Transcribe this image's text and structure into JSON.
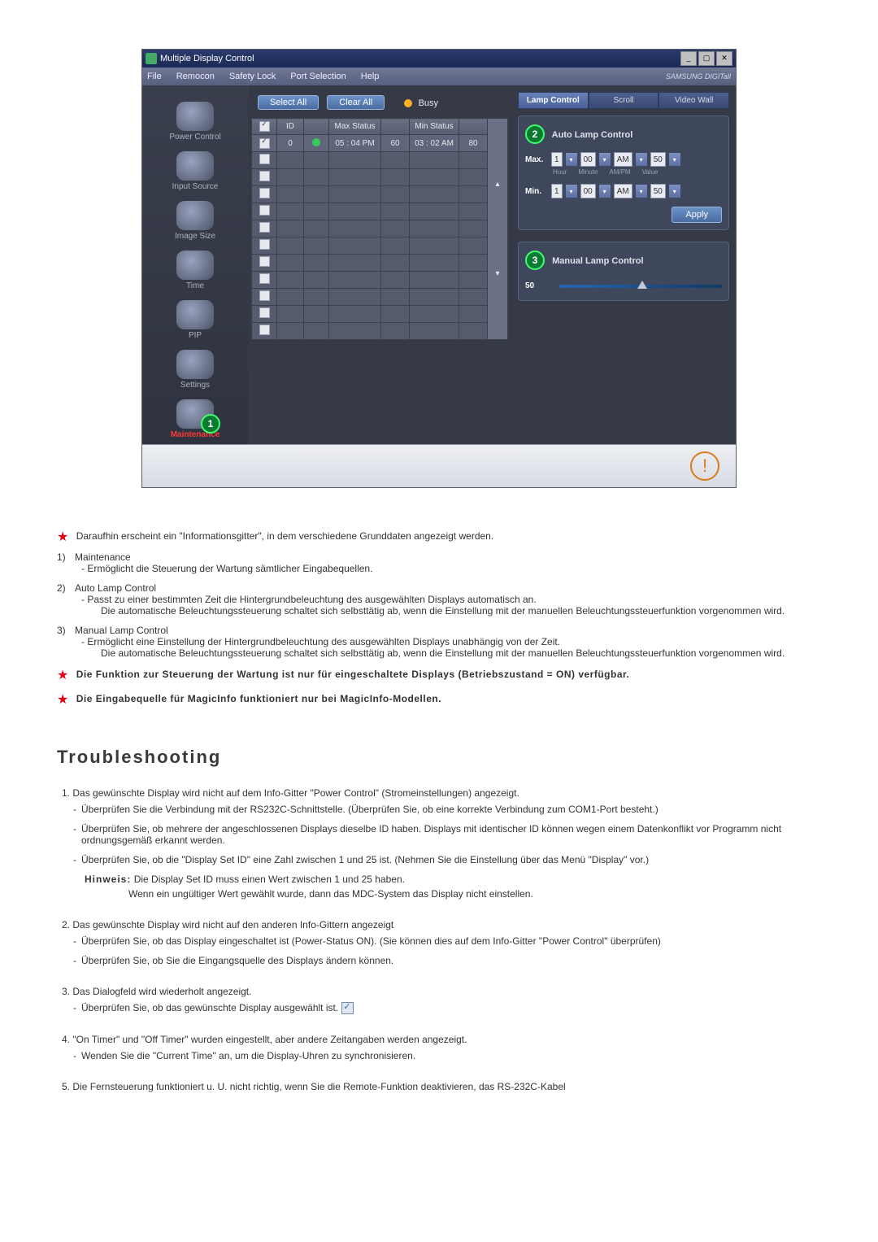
{
  "window": {
    "title": "Multiple Display Control",
    "win_buttons": [
      "_",
      "▢",
      "✕"
    ]
  },
  "menubar": {
    "items": [
      "File",
      "Remocon",
      "Safety Lock",
      "Port Selection",
      "Help"
    ],
    "brand": "SAMSUNG DIGITall"
  },
  "sidebar": {
    "items": [
      {
        "label": "Power Control"
      },
      {
        "label": "Input Source"
      },
      {
        "label": "Image Size"
      },
      {
        "label": "Time"
      },
      {
        "label": "PIP"
      },
      {
        "label": "Settings"
      },
      {
        "label": "Maintenance",
        "active": true,
        "callout": "1"
      }
    ]
  },
  "top_buttons": {
    "select_all": "Select All",
    "clear_all": "Clear All",
    "busy": "Busy"
  },
  "table": {
    "headers": [
      "",
      "ID",
      "",
      "Max Status",
      "",
      "Min Status",
      ""
    ],
    "row0": {
      "id": "0",
      "max_time": "05 : 04 PM",
      "max_val": "60",
      "min_time": "03 : 02 AM",
      "min_val": "80"
    }
  },
  "right": {
    "tabs": {
      "lamp": "Lamp Control",
      "scroll": "Scroll",
      "video": "Video Wall"
    },
    "auto_title": "Auto Lamp Control",
    "auto_callout": "2",
    "rows": {
      "max_label": "Max.",
      "min_label": "Min.",
      "hour": "1",
      "minute": "00",
      "ampm": "AM",
      "value": "50"
    },
    "sublabels": {
      "hour": "Hour",
      "minute": "Minute",
      "ampm": "AM/PM",
      "value": "Value"
    },
    "apply": "Apply",
    "manual_title": "Manual Lamp Control",
    "manual_callout": "3",
    "manual_value": "50"
  },
  "doc": {
    "intro_star": "Daraufhin erscheint ein \"Informationsgitter\", in dem verschiedene Grunddaten angezeigt werden.",
    "l1_num": "1)",
    "l1_title": "Maintenance",
    "l1_sub": "Ermöglicht die Steuerung der Wartung sämtlicher Eingabequellen.",
    "l2_num": "2)",
    "l2_title": "Auto Lamp Control",
    "l2_sub_a": "Passt zu einer bestimmten Zeit die Hintergrundbeleuchtung des ausgewählten Displays automatisch an.",
    "l2_sub_b": "Die automatische Beleuchtungssteuerung schaltet sich selbsttätig ab, wenn die Einstellung mit der manuellen Beleuchtungssteuerfunktion vorgenommen wird.",
    "l3_num": "3)",
    "l3_title": "Manual Lamp Control",
    "l3_sub_a": "Ermöglicht eine Einstellung der Hintergrundbeleuchtung des ausgewählten Displays unabhängig von der Zeit.",
    "l3_sub_b": "Die automatische Beleuchtungssteuerung schaltet sich selbsttätig ab, wenn die Einstellung mit der manuellen Beleuchtungssteuerfunktion vorgenommen wird.",
    "star_note1": "Die Funktion zur Steuerung der Wartung ist nur für eingeschaltete Displays (Betriebszustand = ON) verfügbar.",
    "star_note2": "Die Eingabequelle für MagicInfo funktioniert nur bei MagicInfo-Modellen.",
    "tshoot_heading": "Troubleshooting",
    "t1": {
      "num": "1.",
      "title": "Das gewünschte Display wird nicht auf dem Info-Gitter \"Power Control\" (Stromeinstellungen) angezeigt.",
      "a": "Überprüfen Sie die Verbindung mit der RS232C-Schnittstelle. (Überprüfen Sie, ob eine korrekte Verbindung zum COM1-Port besteht.)",
      "b": "Überprüfen Sie, ob mehrere der angeschlossenen Displays dieselbe ID haben. Displays mit identischer ID können wegen einem Datenkonflikt vor Programm nicht ordnungsgemäß erkannt werden.",
      "c": "Überprüfen Sie, ob die \"Display Set ID\" eine Zahl zwischen 1 und 25 ist. (Nehmen Sie die Einstellung über das Menü \"Display\" vor.)",
      "hinweis_label": "Hinweis:",
      "hinweis_a": "Die Display Set ID muss einen Wert zwischen 1 und 25 haben.",
      "hinweis_b": "Wenn ein ungültiger Wert gewählt wurde, dann das MDC-System das Display nicht einstellen."
    },
    "t2": {
      "num": "2.",
      "title": "Das gewünschte Display wird nicht auf den anderen Info-Gittern angezeigt",
      "a": "Überprüfen Sie, ob das Display eingeschaltet ist (Power-Status ON). (Sie können dies auf dem Info-Gitter \"Power Control\" überprüfen)",
      "b": "Überprüfen Sie, ob Sie die Eingangsquelle des Displays ändern können."
    },
    "t3": {
      "num": "3.",
      "title": "Das Dialogfeld wird wiederholt angezeigt.",
      "a": "Überprüfen Sie, ob das gewünschte Display ausgewählt ist."
    },
    "t4": {
      "num": "4.",
      "title": "\"On Timer\" und \"Off Timer\" wurden eingestellt, aber andere Zeitangaben werden angezeigt.",
      "a": "Wenden Sie die \"Current Time\" an, um die Display-Uhren zu synchronisieren."
    },
    "t5": {
      "num": "5.",
      "title": "Die Fernsteuerung funktioniert u. U. nicht richtig, wenn Sie die Remote-Funktion deaktivieren, das RS-232C-Kabel"
    }
  }
}
